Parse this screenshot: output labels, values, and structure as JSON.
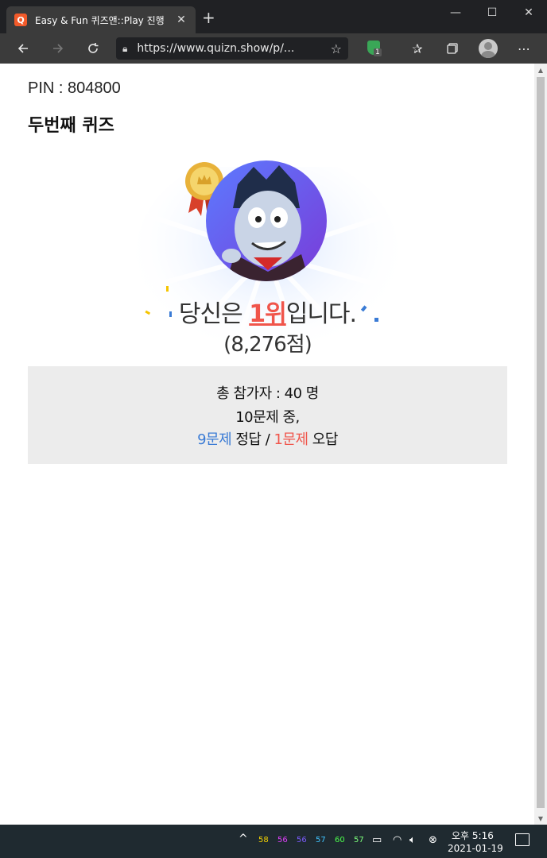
{
  "browser": {
    "tab_favicon": "Q",
    "tab_title": "Easy & Fun 퀴즈앤::Play 진행",
    "url": "https://www.quizn.show/p/...",
    "extension_badge": "1",
    "icons": [
      "back-icon",
      "forward-icon",
      "refresh-icon",
      "lock-icon",
      "star-icon",
      "shield-extension-icon",
      "favorites-icon",
      "collections-icon",
      "profile-icon",
      "more-icon"
    ]
  },
  "page": {
    "pin_label": "PIN : 804800",
    "quiz_title": "두번째 퀴즈",
    "rank_prefix": "당신은 ",
    "rank_value": "1위",
    "rank_suffix": "입니다.",
    "score": "(8,276점)",
    "participants": "총 참가자 : 40 명",
    "question_total": "10문제 중,",
    "correct_count": "9문제",
    "correct_label": " 정답 / ",
    "wrong_count": "1문제",
    "wrong_label": " 오답",
    "colors": {
      "correct": "#3a7bd5",
      "wrong": "#f0554b"
    }
  },
  "taskbar": {
    "tray_numbers": [
      "58",
      "56",
      "56",
      "57",
      "60",
      "57"
    ],
    "time": "오후 5:16",
    "date": "2021-01-19"
  }
}
